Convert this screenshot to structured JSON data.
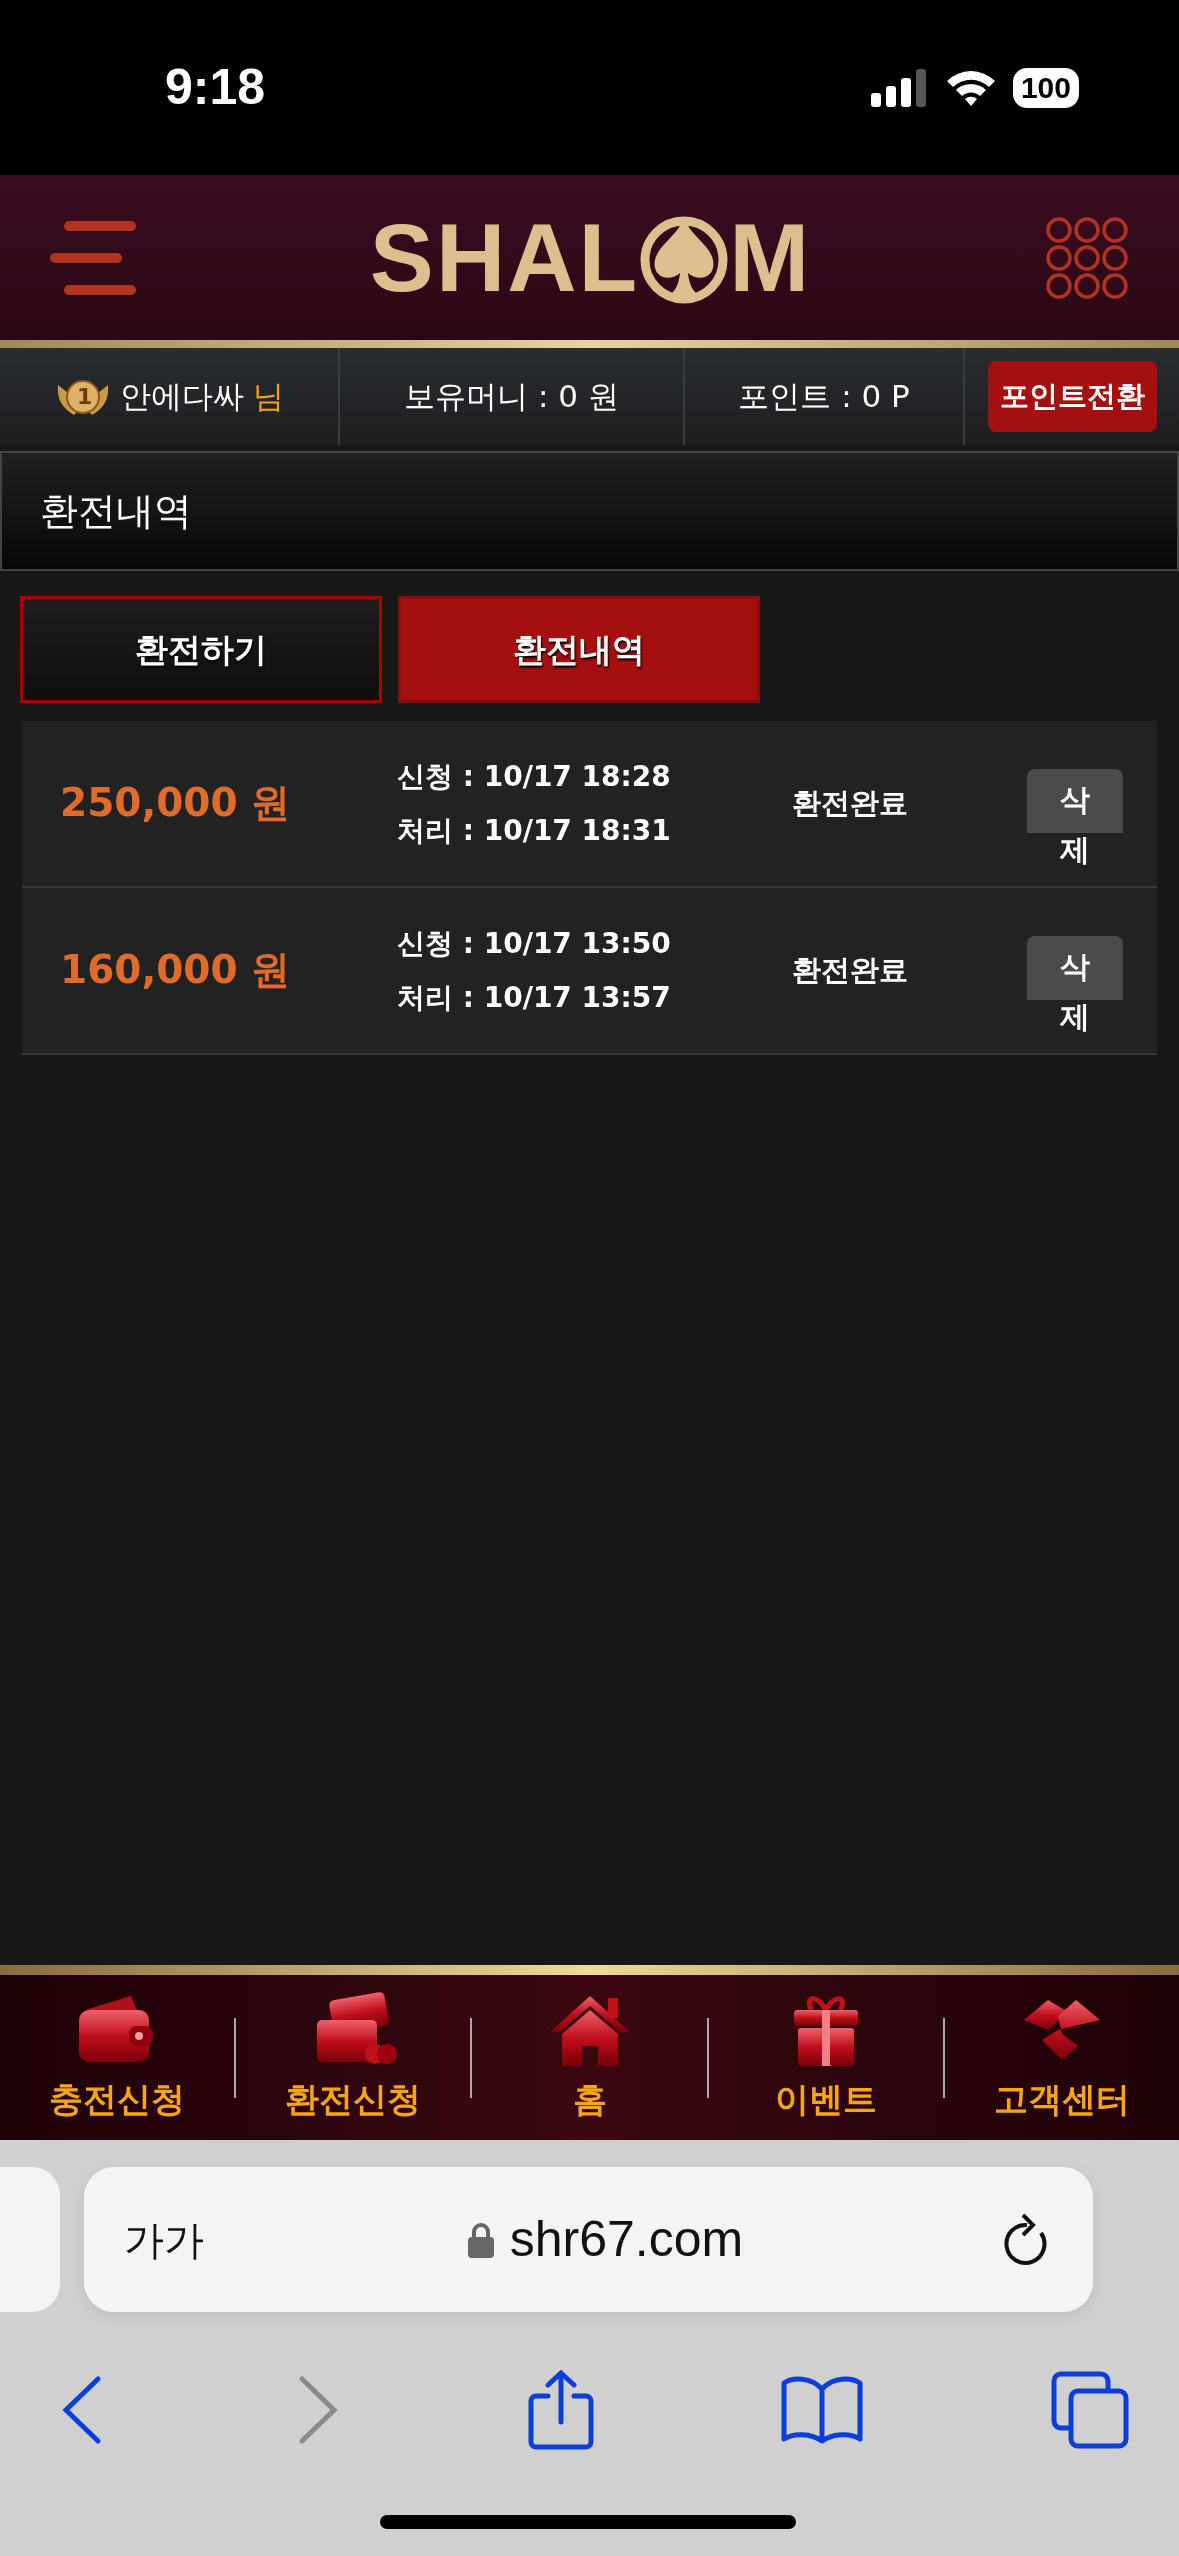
{
  "status_bar": {
    "time": "9:18",
    "battery": "100"
  },
  "header": {
    "logo": {
      "before": "SHAL",
      "after": "M"
    }
  },
  "user_bar": {
    "rank": "1",
    "username": "안에다싸",
    "honorific": "님",
    "money": "보유머니 : 0 원",
    "points": "포인트 : 0 P",
    "convert_button": "포인트전환"
  },
  "page_title": "환전내역",
  "tabs": [
    {
      "label": "환전하기",
      "selected": false
    },
    {
      "label": "환전내역",
      "selected": true
    }
  ],
  "records": [
    {
      "amount": "250,000 원",
      "requested": "신청 : 10/17 18:28",
      "processed": "처리 : 10/17 18:31",
      "status": "환전완료",
      "delete_button": "삭제"
    },
    {
      "amount": "160,000 원",
      "requested": "신청 : 10/17 13:50",
      "processed": "처리 : 10/17 13:57",
      "status": "환전완료",
      "delete_button": "삭제"
    }
  ],
  "bottom_nav": [
    {
      "label": "충전신청",
      "kind": "wallet"
    },
    {
      "label": "환전신청",
      "kind": "exchange"
    },
    {
      "label": "홈",
      "kind": "home"
    },
    {
      "label": "이벤트",
      "kind": "gift"
    },
    {
      "label": "고객센터",
      "kind": "support"
    }
  ],
  "browser": {
    "text_size_button": "가가",
    "url": "shr67.com",
    "back_enabled": true,
    "forward_enabled": false
  }
}
